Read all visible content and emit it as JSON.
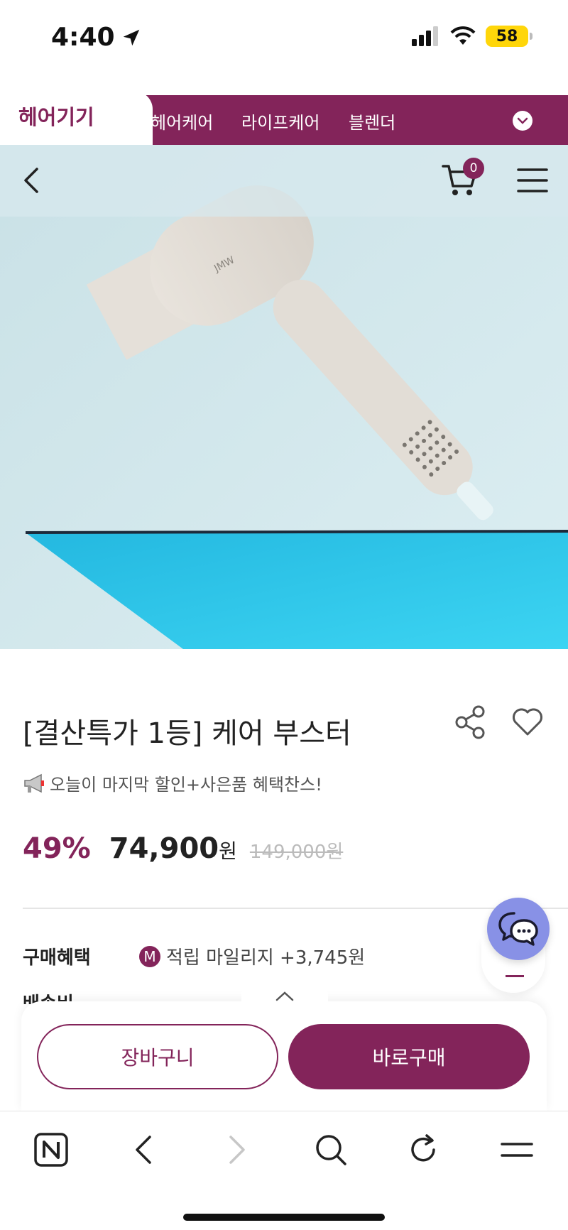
{
  "status_bar": {
    "time": "4:40",
    "battery": "58",
    "icons": [
      "location-arrow-icon",
      "signal-icon",
      "wifi-icon",
      "battery-icon"
    ]
  },
  "categories": {
    "active": "헤어기기",
    "tabs": [
      "헤어케어",
      "라이프케어",
      "블렌더"
    ]
  },
  "header": {
    "cart_count": "0",
    "icons": [
      "back-icon",
      "cart-icon",
      "menu-icon"
    ]
  },
  "product": {
    "title": "[결산특가 1등] 케어 부스터",
    "promo": "오늘이 마지막 할인+사은품 혜택찬스!",
    "discount": "49%",
    "price": "74,900",
    "price_unit": "원",
    "original_price": "149,000원",
    "benefit_label": "구매혜택",
    "mileage_badge": "M",
    "benefit_text": "적립 마일리지 +3,745원",
    "shipping_label_partial": "배송비"
  },
  "actions": {
    "cart": "장바구니",
    "buy": "바로구매"
  },
  "colors": {
    "brand": "#83245a",
    "chat": "#8891e6"
  }
}
